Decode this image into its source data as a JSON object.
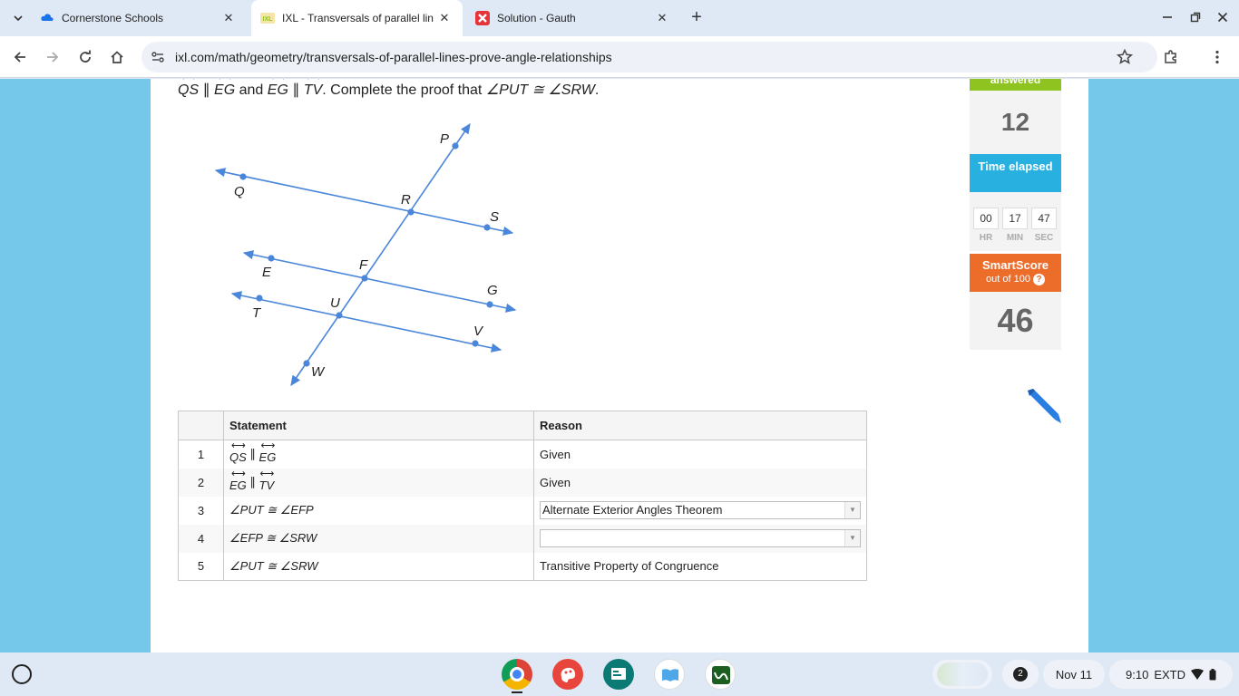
{
  "browser": {
    "tabs": [
      {
        "title": "Cornerstone Schools",
        "favicon": "cornerstone-icon",
        "active": false
      },
      {
        "title": "IXL - Transversals of parallel lin",
        "favicon": "ixl-icon",
        "active": true
      },
      {
        "title": "Solution - Gauth",
        "favicon": "gauth-icon",
        "active": false
      }
    ],
    "url": "ixl.com/math/geometry/transversals-of-parallel-lines-prove-angle-relationships"
  },
  "question": {
    "line1": "QS",
    "parallel": "∥",
    "line2": "EG",
    "and": "and",
    "line3": "EG",
    "line4": "TV",
    "instruction": ". Complete the proof that ",
    "goal": "∠PUT ≅ ∠SRW",
    "end": "."
  },
  "figure": {
    "labels": {
      "P": "P",
      "Q": "Q",
      "R": "R",
      "S": "S",
      "E": "E",
      "F": "F",
      "G": "G",
      "T": "T",
      "U": "U",
      "V": "V",
      "W": "W"
    },
    "line_color": "#4a86d9"
  },
  "proof": {
    "headers": {
      "statement": "Statement",
      "reason": "Reason"
    },
    "rows": [
      {
        "num": "1",
        "s_a": "QS",
        "s_op": "∥",
        "s_b": "EG",
        "reason": "Given"
      },
      {
        "num": "2",
        "s_a": "EG",
        "s_op": "∥",
        "s_b": "TV",
        "reason": "Given"
      },
      {
        "num": "3",
        "statement": "∠PUT  ≅  ∠EFP",
        "reason": "Alternate Exterior Angles Theorem",
        "reason_dropdown": true
      },
      {
        "num": "4",
        "statement": "∠EFP  ≅  ∠SRW",
        "reason": "",
        "reason_dropdown": true
      },
      {
        "num": "5",
        "statement": "∠PUT  ≅  ∠SRW",
        "reason": "Transitive Property of Congruence"
      }
    ]
  },
  "sidebar": {
    "answered_label": "answered",
    "questions_answered": "12",
    "time_label": "Time elapsed",
    "time": {
      "hr": "00",
      "min": "17",
      "sec": "47"
    },
    "time_units": {
      "hr": "HR",
      "min": "MIN",
      "sec": "SEC"
    },
    "smartscore_label": "SmartScore",
    "smartscore_sub": "out of 100",
    "smartscore": "46",
    "colors": {
      "answered": "#8fc31f",
      "time": "#28b1e0",
      "smartscore": "#ec6c2a"
    }
  },
  "shelf": {
    "notification_count": "2",
    "date": "Nov 11",
    "time": "9:10",
    "extd": "EXTD"
  }
}
